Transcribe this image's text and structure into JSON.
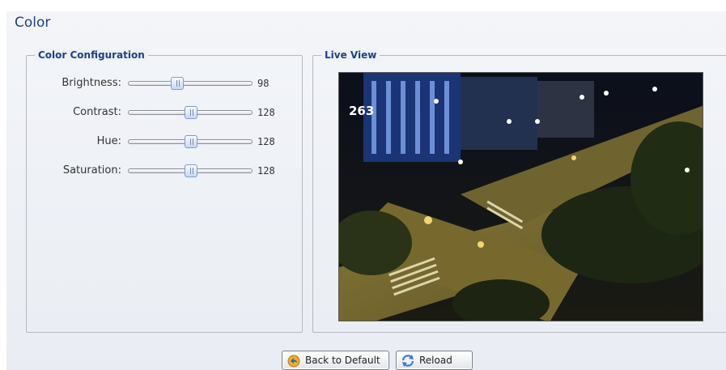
{
  "page": {
    "title": "Color"
  },
  "color_configuration": {
    "legend": "Color Configuration",
    "sliders": [
      {
        "label": "Brightness:",
        "value": "98",
        "level": 0.38
      },
      {
        "label": "Contrast:",
        "value": "128",
        "level": 0.5
      },
      {
        "label": "Hue:",
        "value": "128",
        "level": 0.5
      },
      {
        "label": "Saturation:",
        "value": "128",
        "level": 0.5
      }
    ]
  },
  "live_view": {
    "legend": "Live View",
    "camera_number": "263"
  },
  "buttons": {
    "back_to_default": "Back to Default",
    "reload": "Reload"
  },
  "icons": {
    "back_to_default": "undo-arrow-icon",
    "reload": "refresh-icon"
  }
}
